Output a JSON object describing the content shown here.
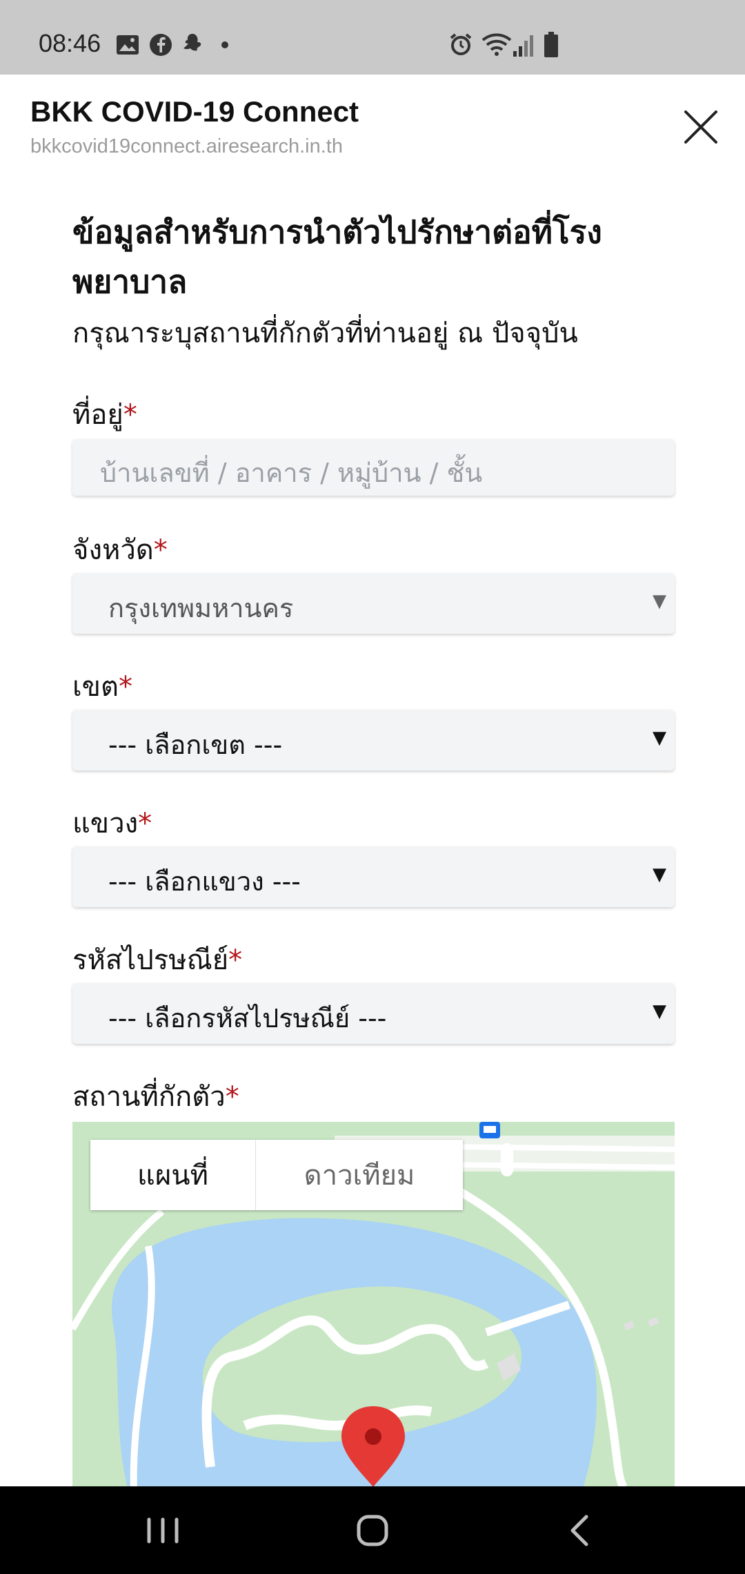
{
  "status_bar": {
    "time": "08:46",
    "left_icons": [
      "gallery-icon",
      "facebook-icon",
      "line-icon",
      "dot-icon"
    ],
    "right_icons": [
      "alarm-icon",
      "wifi-icon",
      "signal-icon",
      "battery-icon"
    ]
  },
  "header": {
    "title": "BKK COVID-19 Connect",
    "url": "bkkcovid19connect.airesearch.in.th",
    "close_icon": "close-icon"
  },
  "form": {
    "title": "ข้อมูลสำหรับการนำตัวไปรักษาต่อที่โรงพยาบาล",
    "subtitle": "กรุณาระบุสถานที่กักตัวที่ท่านอยู่ ณ ปัจจุบัน",
    "required_mark": "*",
    "address": {
      "label": "ที่อยู่",
      "placeholder": "บ้านเลขที่ / อาคาร / หมู่บ้าน / ชั้น"
    },
    "province": {
      "label": "จังหวัด",
      "selected": "กรุงเทพมหานคร"
    },
    "district": {
      "label": "เขต",
      "selected": "--- เลือกเขต ---"
    },
    "subdistrict": {
      "label": "แขวง",
      "selected": "--- เลือกแขวง ---"
    },
    "postal": {
      "label": "รหัสไปรษณีย์",
      "selected": "--- เลือกรหัสไปรษณีย์ ---"
    },
    "location": {
      "label": "สถานที่กักตัว",
      "map_tabs": [
        "แผนที่",
        "ดาวเทียม"
      ],
      "active_tab": "แผนที่"
    }
  },
  "select_arrow": "▼",
  "colors": {
    "required": "#b3151a",
    "map_water": "#aad3f5",
    "map_park": "#c8e6c4",
    "pin": "#e53935"
  }
}
